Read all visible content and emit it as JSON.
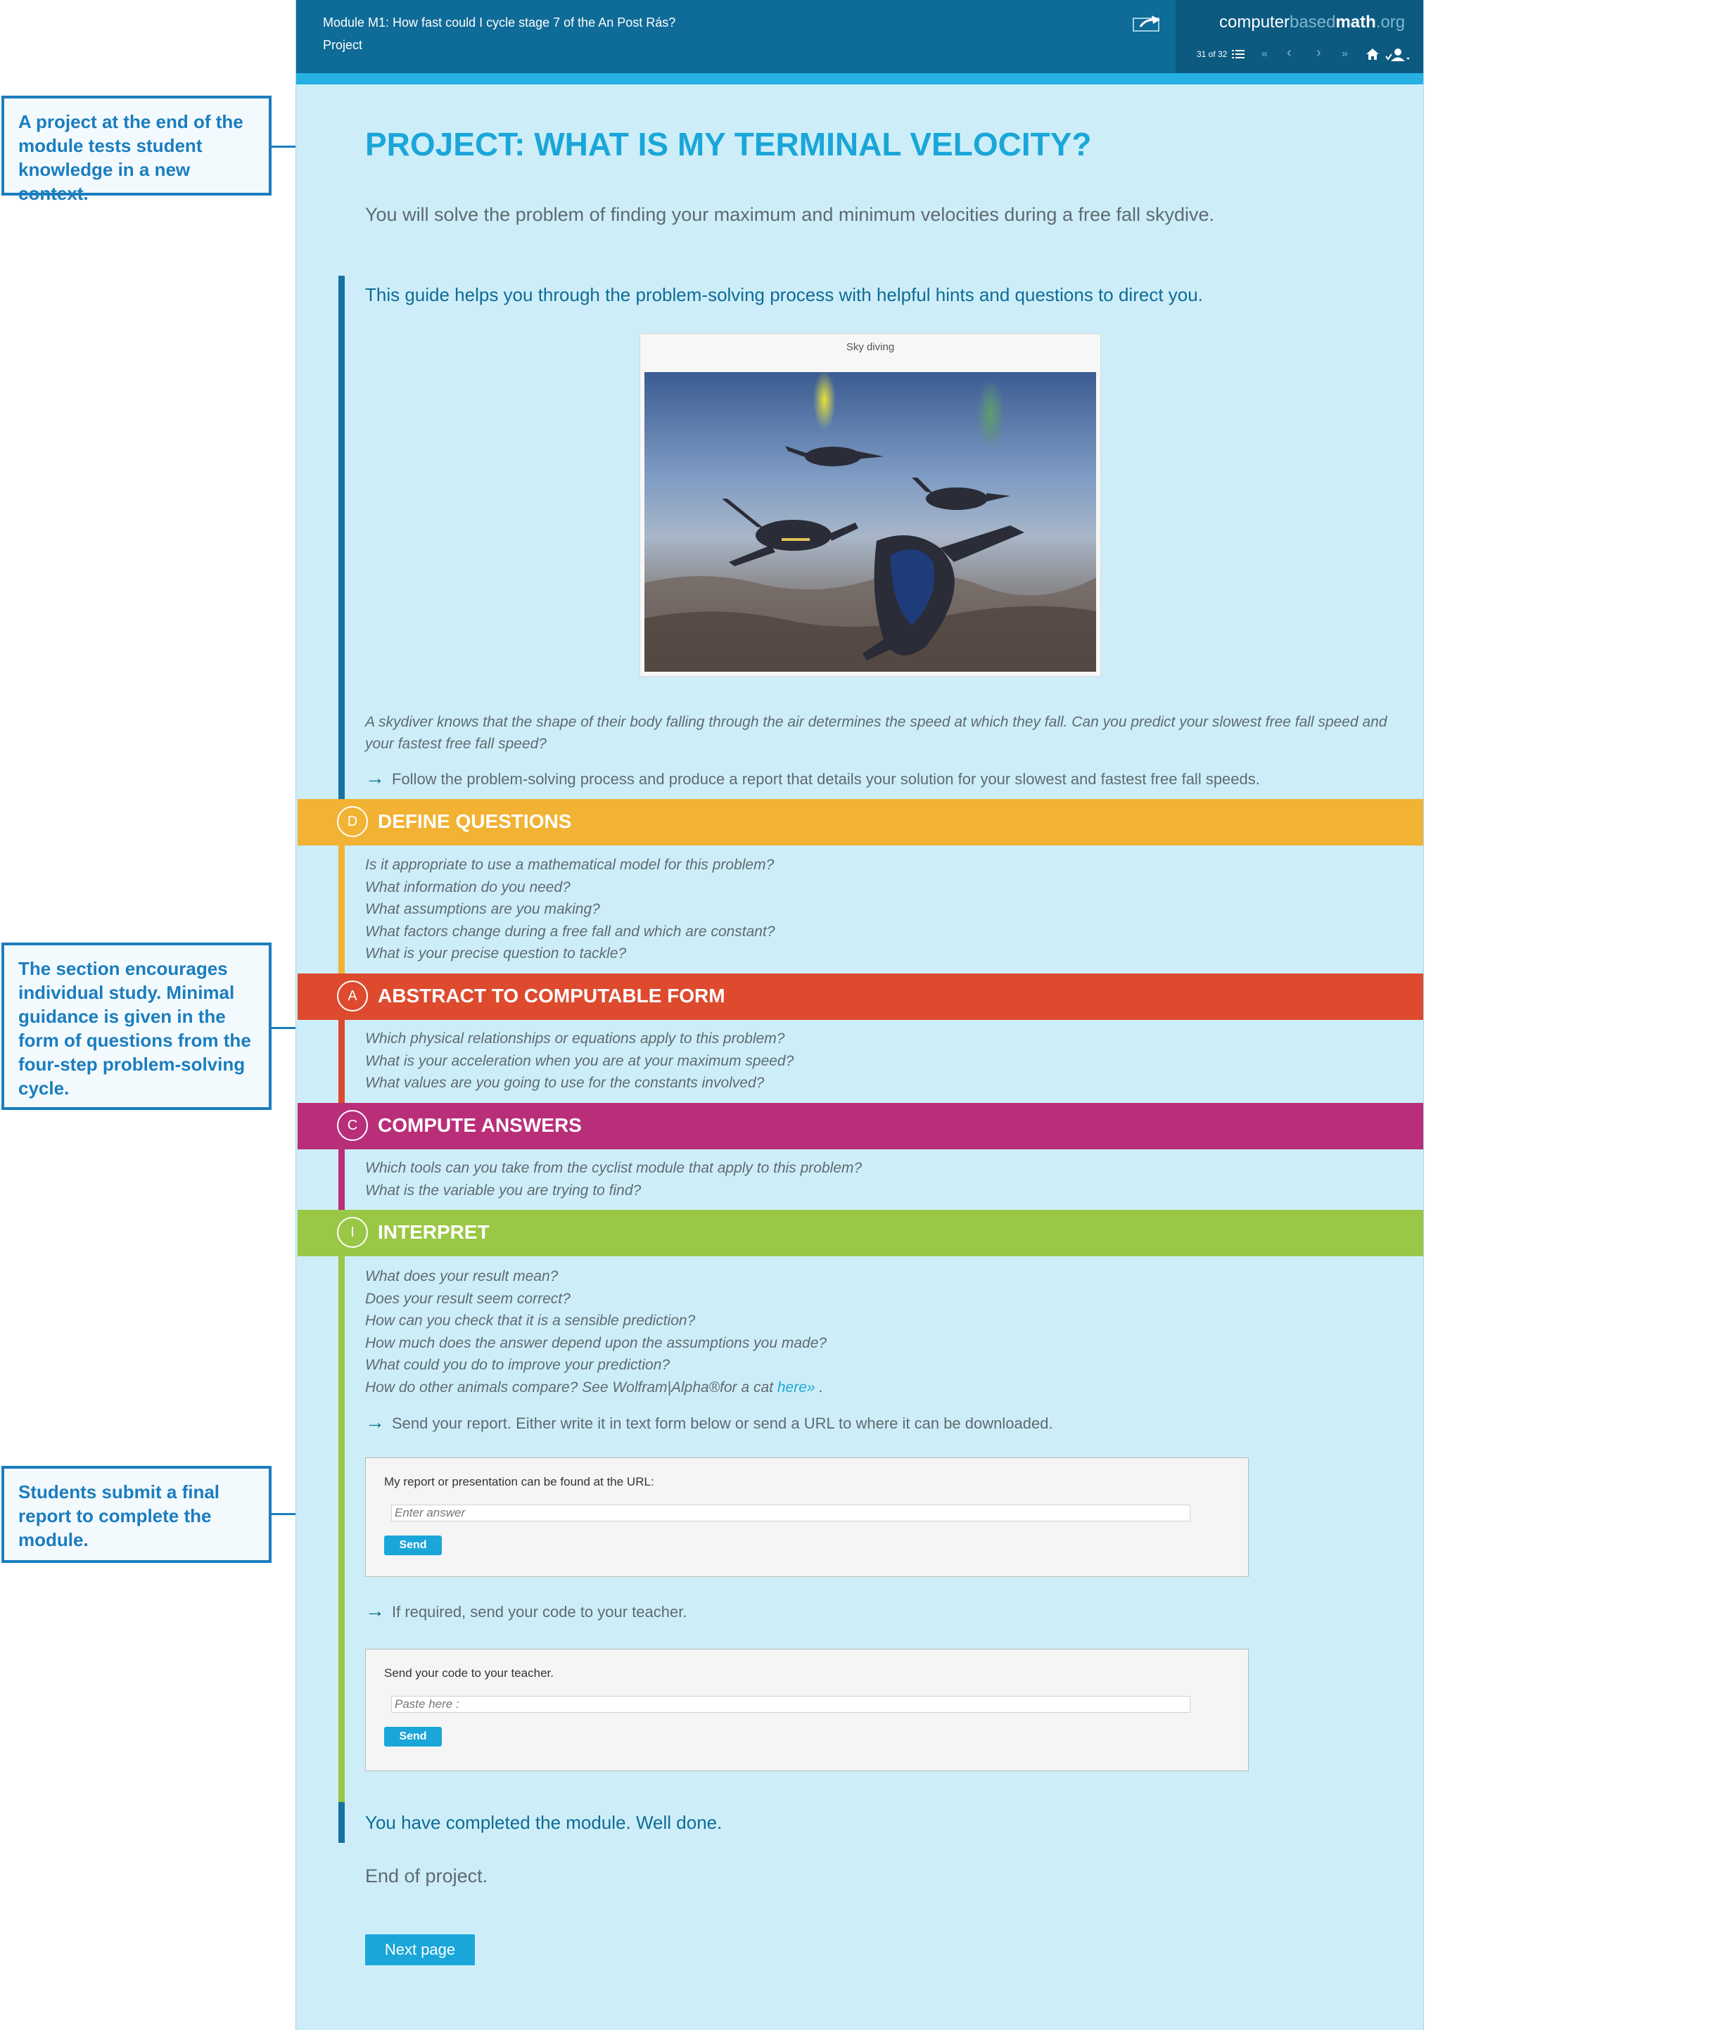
{
  "annotations": {
    "project_note": "A project at the end of the module tests student knowledge in a new context.",
    "section_note": "The section encourages individual study. Minimal guidance is given in the form of questions from the four-step problem-solving cycle.",
    "submit_note": "Students submit a final report to complete the module."
  },
  "header": {
    "module_title": "Module M1: How fast could I cycle stage 7 of the An Post Rás?",
    "section": "Project",
    "brand": {
      "part1": "computer",
      "part2": "based",
      "part3": "math",
      "part4": ".org"
    },
    "page_counter": "31 of 32"
  },
  "icons": [
    "share-icon",
    "contents-icon",
    "first-page-icon",
    "previous-icon",
    "next-icon",
    "last-page-icon",
    "home-icon",
    "user-icon"
  ],
  "colors": {
    "header": "#0f6b97",
    "accent": "#1aa6d9",
    "define": "#f2b233",
    "abstract": "#dd4a2e",
    "compute": "#b92e79",
    "interpret": "#9ac745",
    "background": "#cdeef8"
  },
  "main": {
    "title": "PROJECT: WHAT IS MY TERMINAL VELOCITY?",
    "intro": "You will solve the problem of finding your maximum and minimum velocities during a free fall skydive.",
    "guide": "This guide helps you through the problem-solving process with helpful hints and questions to direct you.",
    "image_caption": "Sky diving",
    "scenario_line1": "A skydiver knows that the shape of their body falling through the air determines the speed at which they fall. Can you predict your slowest free fall speed and",
    "scenario_line2": "your fastest free fall speed?",
    "task": "Follow the problem-solving process and produce a report that details your solution for your slowest and fastest free fall speeds."
  },
  "phases": {
    "define": {
      "letter": "D",
      "label": "DEFINE QUESTIONS",
      "questions": [
        "Is it appropriate to use a mathematical model for this problem?",
        "What information do you need?",
        "What assumptions are you making?",
        "What factors change during a free fall and which are constant?",
        "What is your precise question to tackle?"
      ]
    },
    "abstract": {
      "letter": "A",
      "label": "ABSTRACT TO COMPUTABLE FORM",
      "questions": [
        "Which physical relationships or equations apply to this problem?",
        "What is your acceleration when you are at your maximum speed?",
        "What values are you going to use for the constants involved?"
      ]
    },
    "compute": {
      "letter": "C",
      "label": "COMPUTE ANSWERS",
      "questions": [
        "Which tools can you take from the cyclist module that apply to this problem?",
        "What is the variable you are trying to find?"
      ]
    },
    "interpret": {
      "letter": "I",
      "label": "INTERPRET",
      "questions": [
        "What does your result mean?",
        "Does your result seem correct?",
        "How can you check that it is a sensible prediction?",
        "How much does the answer depend upon the assumptions you made?",
        "What could you do to improve your prediction?"
      ],
      "last_question": "How do other animals compare? See Wolfram|Alpha®for a cat ",
      "link": "here»",
      "last_tail": " ."
    }
  },
  "submission": {
    "send_report_text": "Send your report. Either write it in text form below or send a URL to where it can be downloaded.",
    "url_label": "My report or presentation can be found at the URL:",
    "url_placeholder": "Enter answer",
    "send_label": "Send",
    "code_instruction": "If required, send your code to your teacher.",
    "code_label": "Send your code to your teacher.",
    "code_placeholder": "Paste here :",
    "code_send_label": "Send"
  },
  "footer": {
    "completed": "You have completed the module. Well done.",
    "end": "End of project.",
    "next_label": "Next page"
  }
}
